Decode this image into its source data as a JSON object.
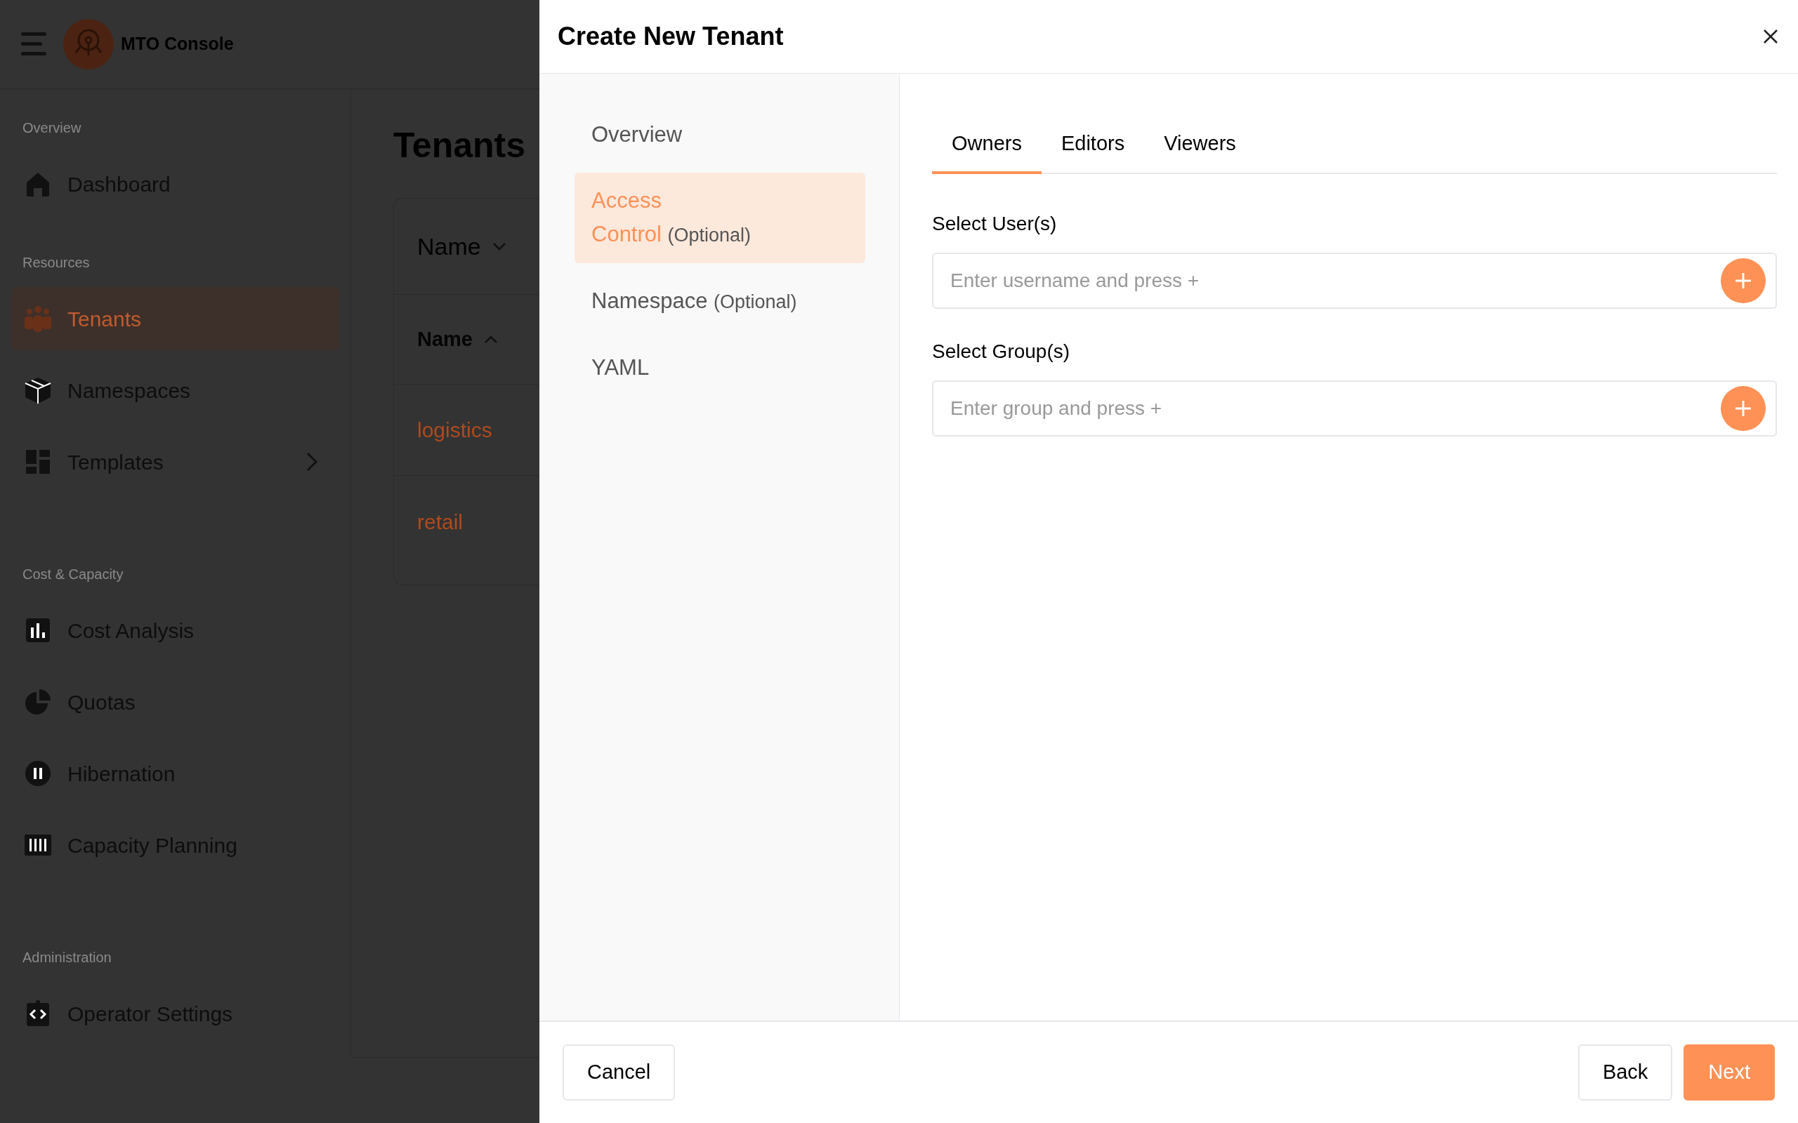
{
  "app_header": {
    "title": "MTO Console"
  },
  "sidebar": {
    "sections": [
      {
        "label": "Overview",
        "items": [
          {
            "label": "Dashboard",
            "selected": false,
            "expandable": false
          }
        ]
      },
      {
        "label": "Resources",
        "items": [
          {
            "label": "Tenants",
            "selected": true,
            "expandable": false
          },
          {
            "label": "Namespaces",
            "selected": false,
            "expandable": false
          },
          {
            "label": "Templates",
            "selected": false,
            "expandable": true
          }
        ]
      },
      {
        "label": "Cost & Capacity",
        "items": [
          {
            "label": "Cost Analysis",
            "selected": false,
            "expandable": false
          },
          {
            "label": "Quotas",
            "selected": false,
            "expandable": false
          },
          {
            "label": "Hibernation",
            "selected": false,
            "expandable": false
          },
          {
            "label": "Capacity Planning",
            "selected": false,
            "expandable": false
          }
        ]
      },
      {
        "label": "Administration",
        "items": [
          {
            "label": "Operator Settings",
            "selected": false,
            "expandable": false
          }
        ]
      }
    ]
  },
  "page": {
    "title": "Tenants",
    "filter": "Name",
    "columns": [
      {
        "label": "Name"
      }
    ],
    "rows": [
      {
        "name": "logistics"
      },
      {
        "name": "retail"
      }
    ]
  },
  "dialog": {
    "title": "Create New Tenant",
    "steps": [
      {
        "label": "Overview",
        "selected": false
      },
      {
        "label": "Access Control",
        "note": "(Optional)",
        "selected": true
      },
      {
        "label": "Namespace",
        "note": "(Optional)",
        "selected": false
      },
      {
        "label": "YAML",
        "selected": false
      }
    ],
    "tabs": [
      {
        "label": "Owners",
        "selected": true
      },
      {
        "label": "Editors",
        "selected": false
      },
      {
        "label": "Viewers",
        "selected": false
      }
    ],
    "fields": [
      {
        "label": "Select User(s)",
        "placeholder": "Enter username and press +"
      },
      {
        "label": "Select Group(s)",
        "placeholder": "Enter group and press +"
      }
    ],
    "buttons_left": [
      {
        "label": "Cancel",
        "kind": "secondary"
      }
    ],
    "buttons_right": [
      {
        "label": "Back",
        "kind": "secondary"
      },
      {
        "label": "Next",
        "kind": "primary"
      }
    ]
  }
}
